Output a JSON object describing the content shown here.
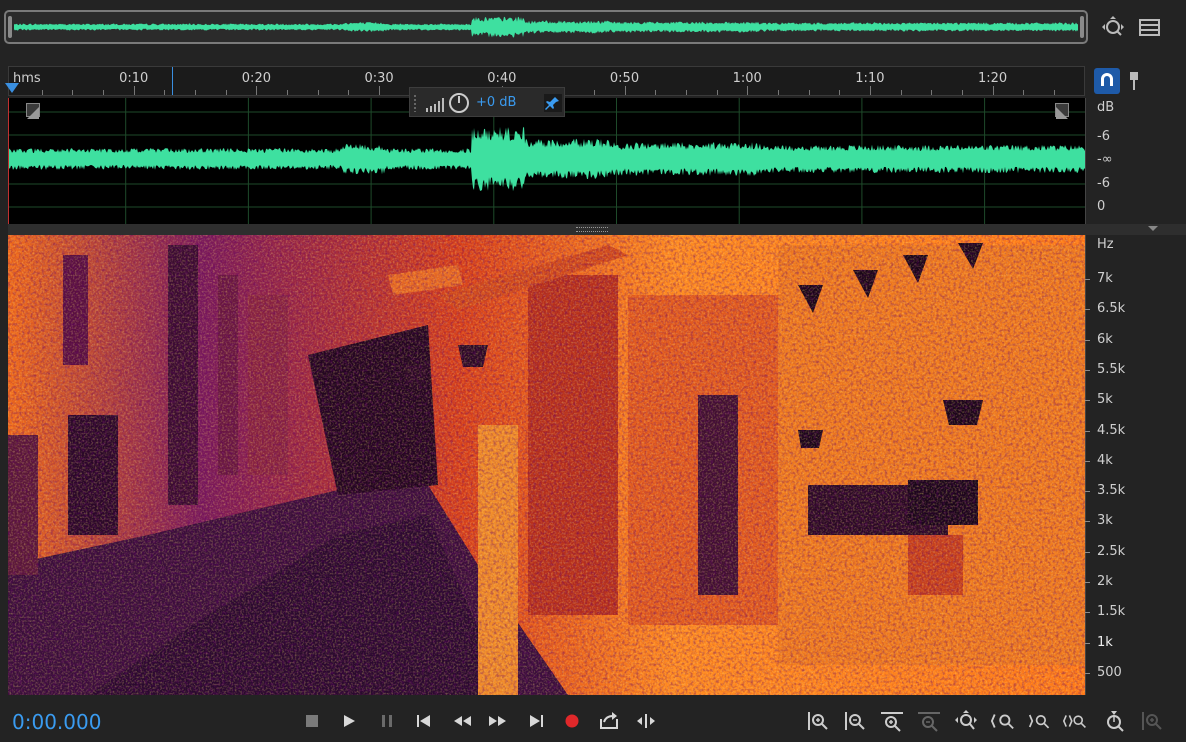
{
  "ruler": {
    "units_label": "hms",
    "ticks": [
      "0:10",
      "0:20",
      "0:30",
      "0:40",
      "0:50",
      "1:00",
      "1:10",
      "1:20"
    ]
  },
  "hud": {
    "volume_value": "+0 dB"
  },
  "amplitude_scale": {
    "unit": "dB",
    "labels": [
      "-6",
      "-∞",
      "-6",
      "0"
    ]
  },
  "frequency_scale": {
    "unit": "Hz",
    "labels": [
      "7k",
      "6.5k",
      "6k",
      "5.5k",
      "5k",
      "4.5k",
      "4k",
      "3.5k",
      "3k",
      "2.5k",
      "2k",
      "1.5k",
      "1k",
      "500"
    ]
  },
  "transport": {
    "current_time": "0:00.000"
  },
  "colors": {
    "waveform": "#3ee0a0",
    "accent": "#3a8fe0",
    "record": "#e0282a",
    "background": "#232323"
  },
  "icons": {
    "top": [
      "zoom-to-selection-icon",
      "list-view-icon",
      "snap-magnet-icon",
      "marker-pin-icon"
    ],
    "transport": [
      "stop-icon",
      "play-icon",
      "pause-icon",
      "skip-to-start-icon",
      "rewind-icon",
      "fast-forward-icon",
      "skip-to-end-icon",
      "record-icon",
      "loop-playback-icon",
      "skip-selection-icon"
    ],
    "zoom": [
      "zoom-in-amplitude-icon",
      "zoom-out-amplitude-icon",
      "zoom-in-time-icon",
      "zoom-out-time-icon",
      "zoom-full-icon",
      "zoom-in-at-start-icon",
      "zoom-in-at-end-icon",
      "zoom-selection-icon",
      "zoom-to-playhead-icon",
      "zoom-out-full-icon"
    ]
  }
}
